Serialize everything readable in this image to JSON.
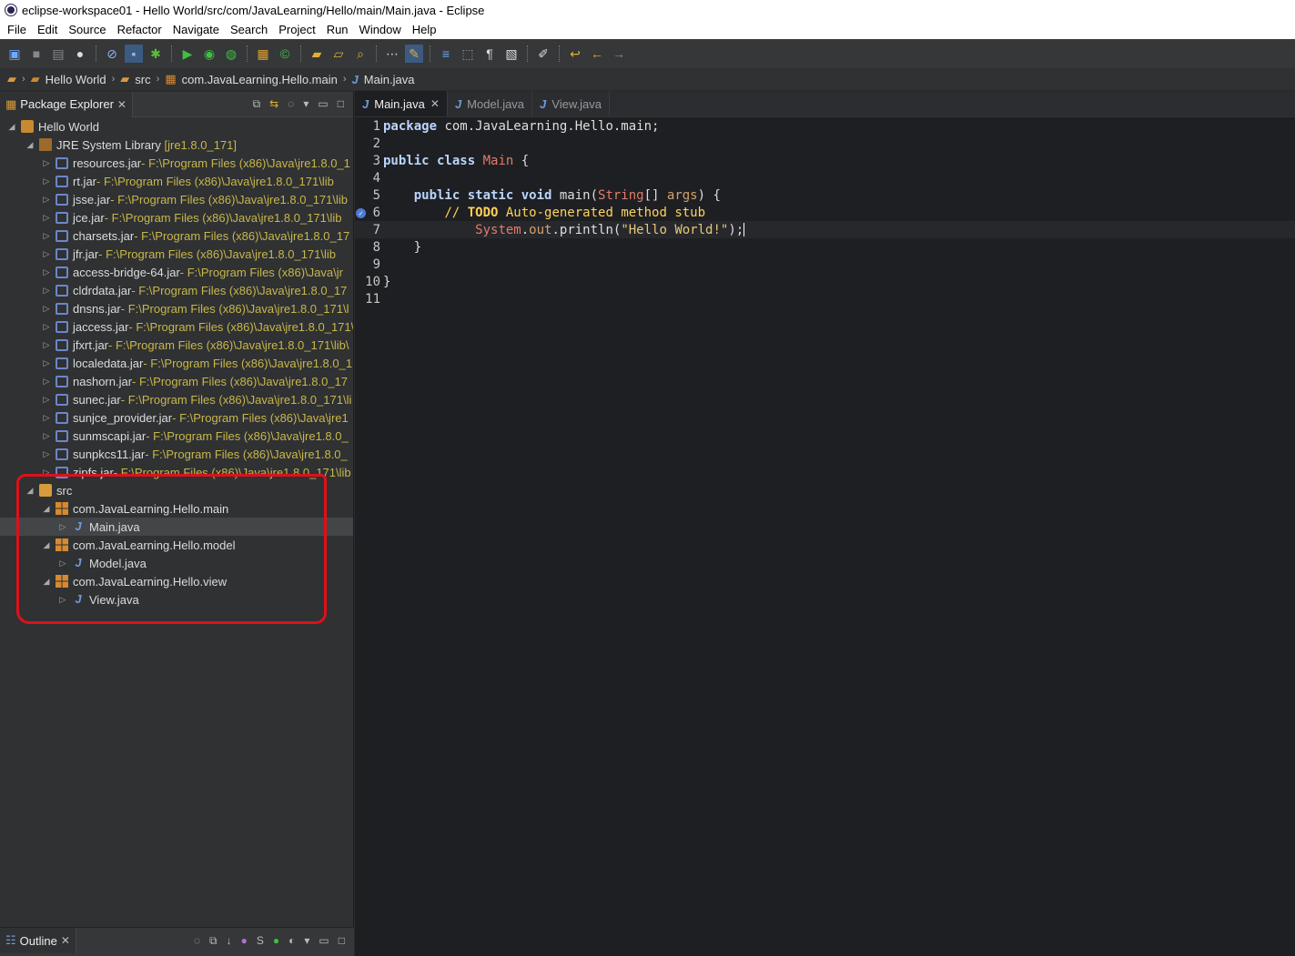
{
  "window": {
    "title": "eclipse-workspace01 - Hello World/src/com/JavaLearning/Hello/main/Main.java - Eclipse"
  },
  "menu": [
    "File",
    "Edit",
    "Source",
    "Refactor",
    "Navigate",
    "Search",
    "Project",
    "Run",
    "Window",
    "Help"
  ],
  "breadcrumb": {
    "project": "Hello World",
    "folder": "src",
    "package": "com.JavaLearning.Hello.main",
    "file": "Main.java"
  },
  "package_explorer": {
    "title": "Package Explorer",
    "project": "Hello World",
    "library": {
      "name": "JRE System Library",
      "version": "[jre1.8.0_171]"
    },
    "jars": [
      {
        "name": "resources.jar",
        "path": " - F:\\Program Files (x86)\\Java\\jre1.8.0_1"
      },
      {
        "name": "rt.jar",
        "path": " - F:\\Program Files (x86)\\Java\\jre1.8.0_171\\lib"
      },
      {
        "name": "jsse.jar",
        "path": " - F:\\Program Files (x86)\\Java\\jre1.8.0_171\\lib"
      },
      {
        "name": "jce.jar",
        "path": " - F:\\Program Files (x86)\\Java\\jre1.8.0_171\\lib"
      },
      {
        "name": "charsets.jar",
        "path": " - F:\\Program Files (x86)\\Java\\jre1.8.0_17"
      },
      {
        "name": "jfr.jar",
        "path": " - F:\\Program Files (x86)\\Java\\jre1.8.0_171\\lib"
      },
      {
        "name": "access-bridge-64.jar",
        "path": " - F:\\Program Files (x86)\\Java\\jr"
      },
      {
        "name": "cldrdata.jar",
        "path": " - F:\\Program Files (x86)\\Java\\jre1.8.0_17"
      },
      {
        "name": "dnsns.jar",
        "path": " - F:\\Program Files (x86)\\Java\\jre1.8.0_171\\l"
      },
      {
        "name": "jaccess.jar",
        "path": " - F:\\Program Files (x86)\\Java\\jre1.8.0_171\\"
      },
      {
        "name": "jfxrt.jar",
        "path": " - F:\\Program Files (x86)\\Java\\jre1.8.0_171\\lib\\"
      },
      {
        "name": "localedata.jar",
        "path": " - F:\\Program Files (x86)\\Java\\jre1.8.0_1"
      },
      {
        "name": "nashorn.jar",
        "path": " - F:\\Program Files (x86)\\Java\\jre1.8.0_17"
      },
      {
        "name": "sunec.jar",
        "path": " - F:\\Program Files (x86)\\Java\\jre1.8.0_171\\li"
      },
      {
        "name": "sunjce_provider.jar",
        "path": " - F:\\Program Files (x86)\\Java\\jre1"
      },
      {
        "name": "sunmscapi.jar",
        "path": " - F:\\Program Files (x86)\\Java\\jre1.8.0_"
      },
      {
        "name": "sunpkcs11.jar",
        "path": " - F:\\Program Files (x86)\\Java\\jre1.8.0_"
      },
      {
        "name": "zipfs.jar",
        "path": " - F:\\Program Files (x86)\\Java\\jre1.8.0_171\\lib"
      }
    ],
    "src": "src",
    "packages": [
      {
        "name": "com.JavaLearning.Hello.main",
        "file": "Main.java"
      },
      {
        "name": "com.JavaLearning.Hello.model",
        "file": "Model.java"
      },
      {
        "name": "com.JavaLearning.Hello.view",
        "file": "View.java"
      }
    ]
  },
  "outline": {
    "title": "Outline"
  },
  "editor": {
    "tabs": [
      "Main.java",
      "Model.java",
      "View.java"
    ],
    "line_numbers": [
      "1",
      "2",
      "3",
      "4",
      "5",
      "6",
      "7",
      "8",
      "9",
      "10",
      "11"
    ],
    "code": {
      "l1_kw": "package",
      "l1_rest": " com.JavaLearning.Hello.main;",
      "l3_kw": "public class",
      "l3_cls": "Main",
      "l3_rest": " {",
      "l5_indent": "    ",
      "l5_kw": "public static void",
      "l5_m": " main(",
      "l5_type": "String",
      "l5_arr": "[] ",
      "l5_arg": "args",
      "l5_rest": ") {",
      "l6_indent": "        ",
      "l6_cmt": "// ",
      "l6_todo": "TODO",
      "l6_rest": " Auto-generated method stub",
      "l7_indent": "            ",
      "l7_sys": "System",
      "l7_dot": ".",
      "l7_out": "out",
      "l7_call": ".println(",
      "l7_str": "\"Hello World!\"",
      "l7_end": ");",
      "l8": "    }",
      "l10": "}"
    }
  },
  "colors": {
    "annotation_red": "#e0101a",
    "accent_blue": "#4d7bd6"
  }
}
